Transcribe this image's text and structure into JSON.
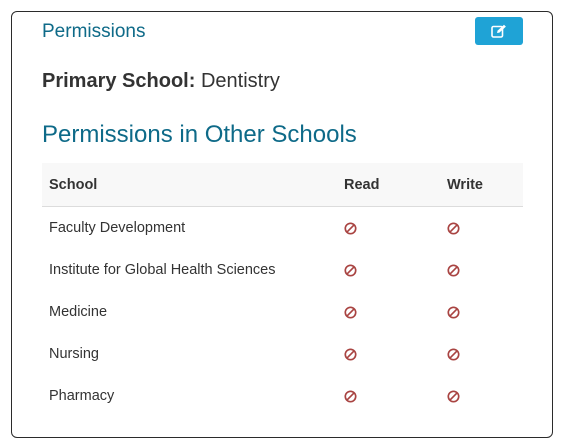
{
  "panel": {
    "title": "Permissions",
    "edit_icon": "edit-icon",
    "accent_color": "#1fa3d6",
    "title_color": "#0e6a88"
  },
  "primary_school": {
    "label": "Primary School:",
    "value": "Dentistry"
  },
  "other_schools": {
    "title": "Permissions in Other Schools",
    "columns": [
      "School",
      "Read",
      "Write"
    ],
    "rows": [
      {
        "school": "Faculty Development",
        "read": "not-allowed-icon",
        "write": "not-allowed-icon"
      },
      {
        "school": "Institute for Global Health Sciences",
        "read": "not-allowed-icon",
        "write": "not-allowed-icon"
      },
      {
        "school": "Medicine",
        "read": "not-allowed-icon",
        "write": "not-allowed-icon"
      },
      {
        "school": "Nursing",
        "read": "not-allowed-icon",
        "write": "not-allowed-icon"
      },
      {
        "school": "Pharmacy",
        "read": "not-allowed-icon",
        "write": "not-allowed-icon"
      }
    ],
    "denied_color": "#a94442"
  }
}
